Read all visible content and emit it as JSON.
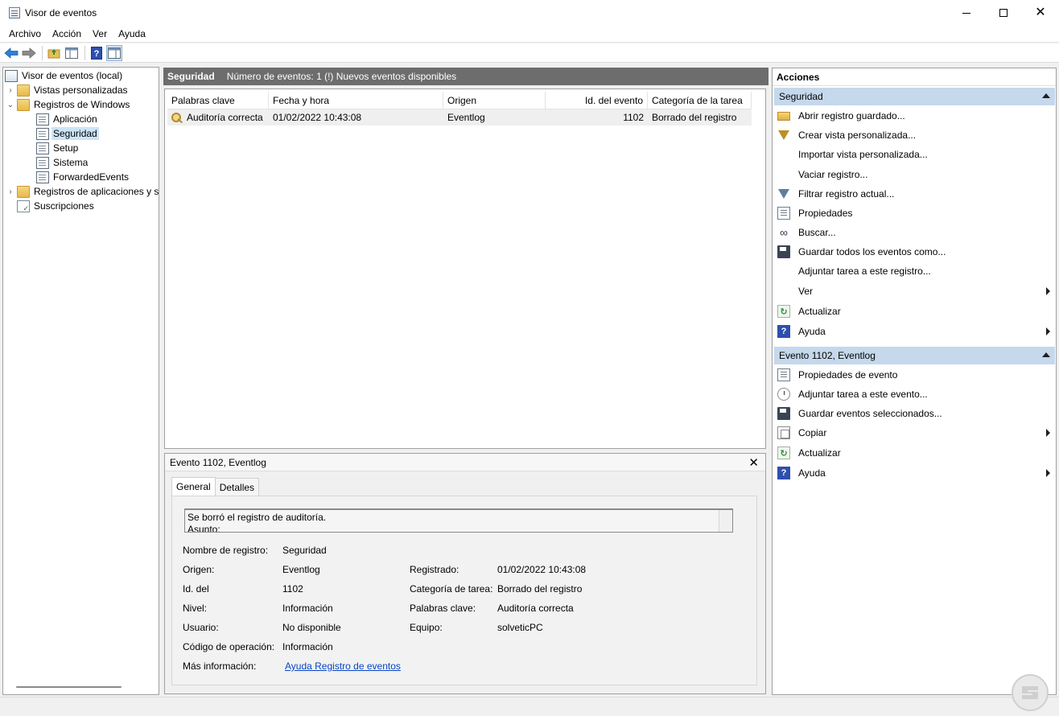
{
  "window": {
    "title": "Visor de eventos"
  },
  "menu": [
    "Archivo",
    "Acción",
    "Ver",
    "Ayuda"
  ],
  "toolbar": [
    "back-icon",
    "forward-icon",
    "up-folder-icon",
    "show-hide-tree-icon",
    "help-icon",
    "show-hide-action-pane-icon"
  ],
  "tree": {
    "root": "Visor de eventos (local)",
    "custom_views": "Vistas personalizadas",
    "windows_logs": "Registros de Windows",
    "application": "Aplicación",
    "security": "Seguridad",
    "setup": "Setup",
    "system": "Sistema",
    "forwarded": "ForwardedEvents",
    "app_services": "Registros de aplicaciones y s",
    "subscriptions": "Suscripciones"
  },
  "center": {
    "log_name": "Seguridad",
    "summary": "Número de eventos: 1 (!) Nuevos eventos disponibles",
    "columns": [
      "Palabras clave",
      "Fecha y hora",
      "Origen",
      "Id. del evento",
      "Categoría de la tarea"
    ],
    "rows": [
      {
        "keywords": "Auditoría correcta",
        "datetime": "01/02/2022 10:43:08",
        "source": "Eventlog",
        "event_id": "1102",
        "category": "Borrado del registro"
      }
    ]
  },
  "detail": {
    "title": "Evento 1102, Eventlog",
    "tabs": [
      "General",
      "Detalles"
    ],
    "description_line1": "Se borró el registro de auditoría.",
    "description_line2": "Asunto:",
    "labels": {
      "log_name": "Nombre de registro:",
      "source": "Origen:",
      "event_id": "Id. del",
      "level": "Nivel:",
      "user": "Usuario:",
      "opcode": "Código de operación:",
      "more_info": "Más información:",
      "logged": "Registrado:",
      "task_category": "Categoría de tarea:",
      "keywords": "Palabras clave:",
      "computer": "Equipo:"
    },
    "values": {
      "log_name": "Seguridad",
      "source": "Eventlog",
      "event_id": "1102",
      "level": "Información",
      "user": "No disponible",
      "opcode": "Información",
      "more_info": "Ayuda Registro de eventos",
      "logged": "01/02/2022 10:43:08",
      "task_category": "Borrado del registro",
      "keywords": "Auditoría correcta",
      "computer": "solveticPC"
    }
  },
  "actions": {
    "title": "Acciones",
    "section1": {
      "title": "Seguridad",
      "items": [
        "Abrir registro guardado...",
        "Crear vista personalizada...",
        "Importar vista personalizada...",
        "Vaciar registro...",
        "Filtrar registro actual...",
        "Propiedades",
        "Buscar...",
        "Guardar todos los eventos como...",
        "Adjuntar tarea a este registro...",
        "Ver",
        "Actualizar",
        "Ayuda"
      ]
    },
    "section2": {
      "title": "Evento 1102, Eventlog",
      "items": [
        "Propiedades de evento",
        "Adjuntar tarea a este evento...",
        "Guardar eventos seleccionados...",
        "Copiar",
        "Actualizar",
        "Ayuda"
      ]
    }
  },
  "colors": {
    "center_header": "#6d6d6d",
    "actions_section": "#c5d8ec",
    "selection": "#cce4f7",
    "link": "#0645c8"
  }
}
